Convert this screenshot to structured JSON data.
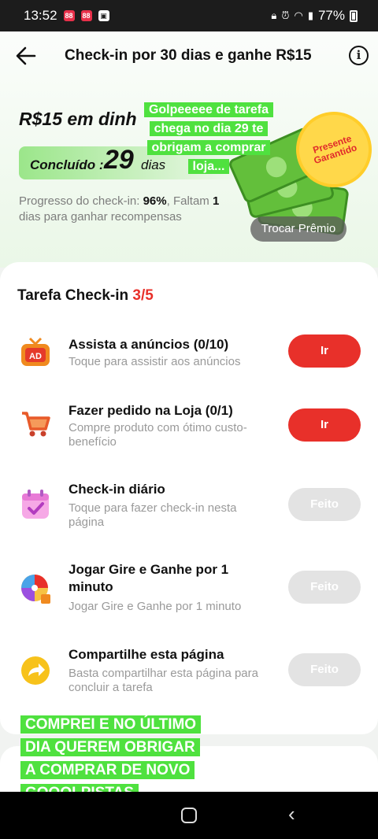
{
  "status_bar": {
    "time": "13:52",
    "battery": "77%"
  },
  "header": {
    "title": "Check-in por 30 dias e ganhe R$15",
    "info_icon": "i"
  },
  "reward": {
    "title": "R$15 em dinh",
    "done_label": "Concluído :",
    "done_number": "29",
    "done_unit": "dias",
    "progress_label": "Progresso do check-in:",
    "progress_value": "96%",
    "remaining_prefix": ", Faltam",
    "remaining_value": "1",
    "remaining_suffix": "dias para ganhar recompensas",
    "badge": "Presente Garantido",
    "trocar_button": "Trocar Prêmio",
    "progress_fraction": 0.96
  },
  "overlay_top": "Golpeeeee de tarefa chega no dia 29 te obrigam a comprar loja...",
  "tasks_card": {
    "title": "Tarefa Check-in",
    "count": "3/5",
    "tasks": [
      {
        "name": "Assista a anúncios  (0/10)",
        "desc": "Toque para assistir aos anúncios",
        "button": "Ir",
        "icon": "ad-tv-icon"
      },
      {
        "name": "Fazer pedido na Loja  (0/1)",
        "desc": "Compre produto com ótimo custo-benefício",
        "button": "Ir",
        "icon": "shopping-cart-icon"
      },
      {
        "name": "Check-in diário",
        "desc": "Toque para fazer check-in nesta página",
        "button": "Feito",
        "icon": "calendar-check-icon"
      },
      {
        "name": "Jogar Gire e Ganhe por 1 minuto",
        "desc": "Jogar Gire e Ganhe por 1 minuto",
        "button": "Feito",
        "icon": "prize-wheel-icon"
      },
      {
        "name": "Compartilhe esta página",
        "desc": "Basta compartilhar esta página para concluir a tarefa",
        "button": "Feito",
        "icon": "share-arrow-icon"
      }
    ]
  },
  "overlay_bottom": "COMPREI E NO ÚLTIMO DIA QUEREM OBRIGAR A COMPRAR DE NOVO GOOOLPISTAS",
  "colors": {
    "accent": "#e8302a",
    "green_overlay": "#4fe13f",
    "done_button": "#e3e3e3"
  }
}
